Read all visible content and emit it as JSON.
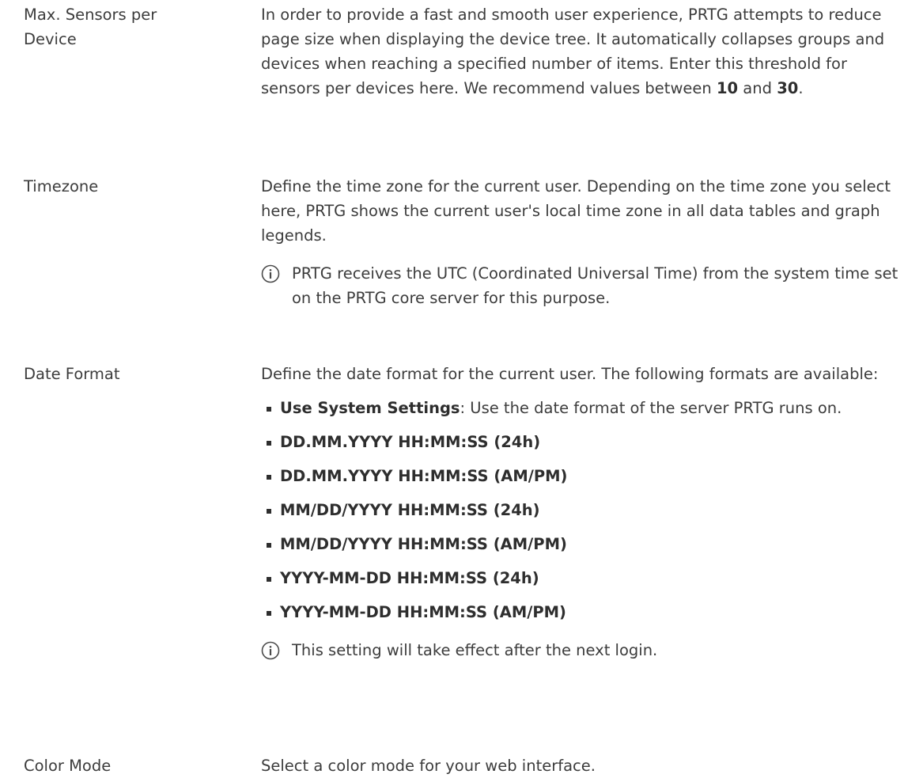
{
  "max_sensors": {
    "label_line1": "Max. Sensors per",
    "label_line2": "Device",
    "description": "In order to provide a fast and smooth user experience, PRTG attempts to reduce page size when displaying the device tree. It automatically collapses groups and devices when reaching a specified number of items. Enter this threshold for sensors per devices here. We recommend values between ",
    "value_min": "10",
    "and_text": " and ",
    "value_max": "30",
    "end_text": "."
  },
  "timezone": {
    "label": "Timezone",
    "description": "Define the time zone for the current user. Depending on the time zone you select here, PRTG shows the current user's local time zone in all data tables and graph legends.",
    "note": "PRTG receives the UTC (Coordinated Universal Time) from the system time set on the PRTG core server for this purpose."
  },
  "date_format": {
    "label": "Date Format",
    "description": "Define the date format for the current user. The following formats are available:",
    "first_option_name": "Use System Settings",
    "first_option_text": ": Use the date format of the server PRTG runs on.",
    "options": [
      "DD.MM.YYYY HH:MM:SS (24h)",
      "DD.MM.YYYY HH:MM:SS (AM/PM)",
      "MM/DD/YYYY HH:MM:SS (24h)",
      "MM/DD/YYYY HH:MM:SS (AM/PM)",
      "YYYY-MM-DD HH:MM:SS (24h)",
      "YYYY-MM-DD HH:MM:SS (AM/PM)"
    ],
    "note": "This setting will take effect after the next login."
  },
  "color_mode": {
    "label": "Color Mode",
    "description": "Select a color mode for your web interface."
  },
  "colors": {
    "text": "#3c3c3c",
    "icon": "#4a4a4a"
  }
}
